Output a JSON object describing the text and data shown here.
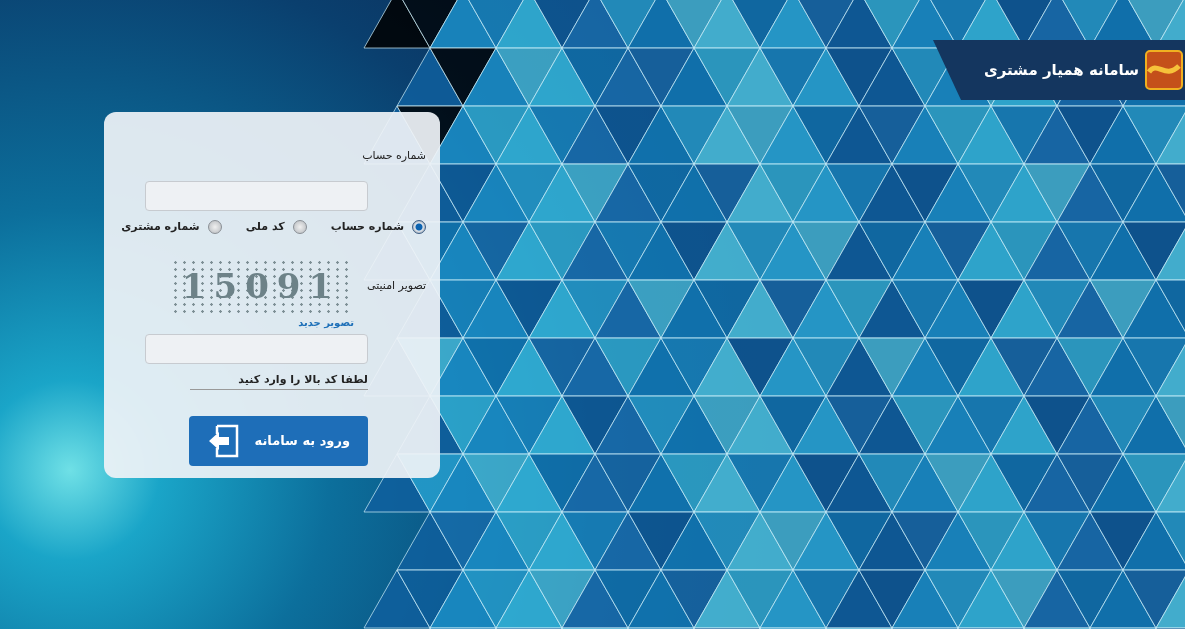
{
  "header": {
    "title": "سامانه همیار مشتری"
  },
  "login": {
    "account_label": "شماره حساب",
    "id_types": [
      {
        "label": "شماره حساب",
        "selected": true
      },
      {
        "label": "کد ملی",
        "selected": false
      },
      {
        "label": "شماره مشتری",
        "selected": false
      }
    ],
    "captcha_label": "تصویر امنیتی",
    "captcha_text": "15091",
    "new_captcha_link": "تصویر جدید",
    "captcha_hint": "لطفا کد بالا را وارد کنید",
    "submit": "ورود به سامانه"
  }
}
